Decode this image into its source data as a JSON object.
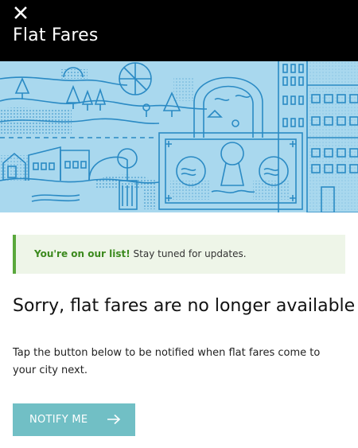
{
  "header": {
    "close_icon": "close-icon",
    "title": "Flat Fares",
    "background": "#000000"
  },
  "hero": {
    "icon": "city-illustration",
    "background": "#a9d8ee",
    "line_color": "#2a8ac4"
  },
  "banner": {
    "strong": "You're on our list!",
    "text": " Stay tuned for updates.",
    "accent": "#5aa83c"
  },
  "headline": "Sorry, flat fares are no longer available",
  "body": "Tap the button below to be notified when flat fares come to your city next.",
  "notify_button": {
    "label": "NOTIFY ME",
    "icon": "arrow-right-icon",
    "color": "#71bfc5"
  }
}
